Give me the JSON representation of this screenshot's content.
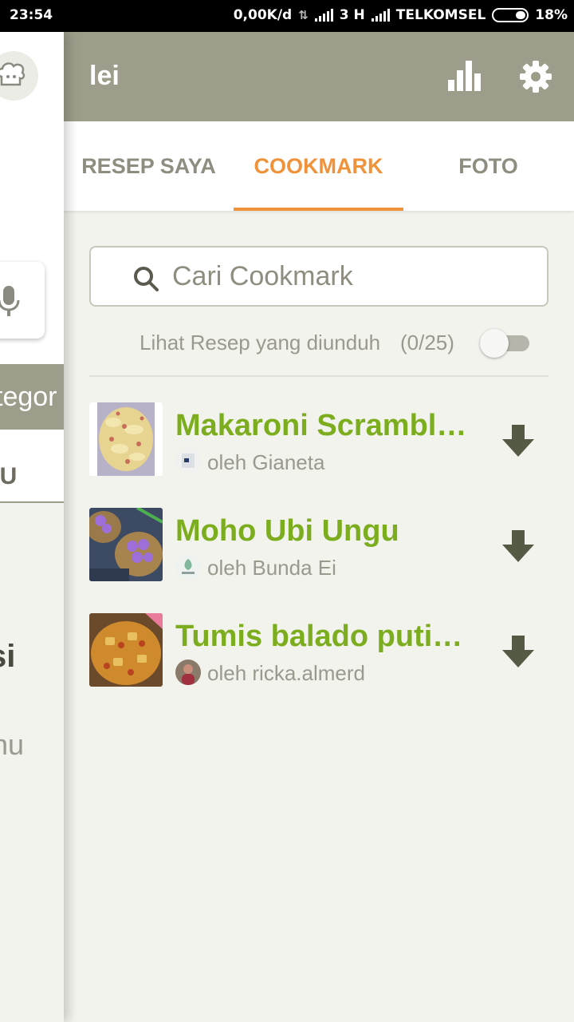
{
  "status_bar": {
    "time": "23:54",
    "speed": "0,00K/d",
    "network_type": "3 H",
    "carrier": "TELKOMSEL",
    "battery": "18%"
  },
  "drawer": {
    "category_fragment": "tegor",
    "ku_fragment": "KU",
    "si_fragment": "si",
    "mu_fragment": "nu"
  },
  "header": {
    "title": "lei"
  },
  "tabs": [
    {
      "label": "RESEP SAYA"
    },
    {
      "label": "COOKMARK",
      "active": true
    },
    {
      "label": "FOTO"
    }
  ],
  "search": {
    "placeholder": "Cari Cookmark",
    "value": ""
  },
  "downloaded": {
    "label": "Lihat Resep yang diunduh",
    "count": "(0/25)",
    "enabled": false
  },
  "recipes": [
    {
      "title": "Makaroni Scrambl…",
      "author": "oleh Gianeta"
    },
    {
      "title": "Moho Ubi Ungu",
      "author": "oleh Bunda Ei"
    },
    {
      "title": "Tumis balado puti…",
      "author": "oleh ricka.almerd"
    }
  ],
  "colors": {
    "header_bg": "#9e9c8a",
    "tab_active": "#f0923a",
    "recipe_title": "#7cad1e",
    "download_icon": "#555a45"
  }
}
